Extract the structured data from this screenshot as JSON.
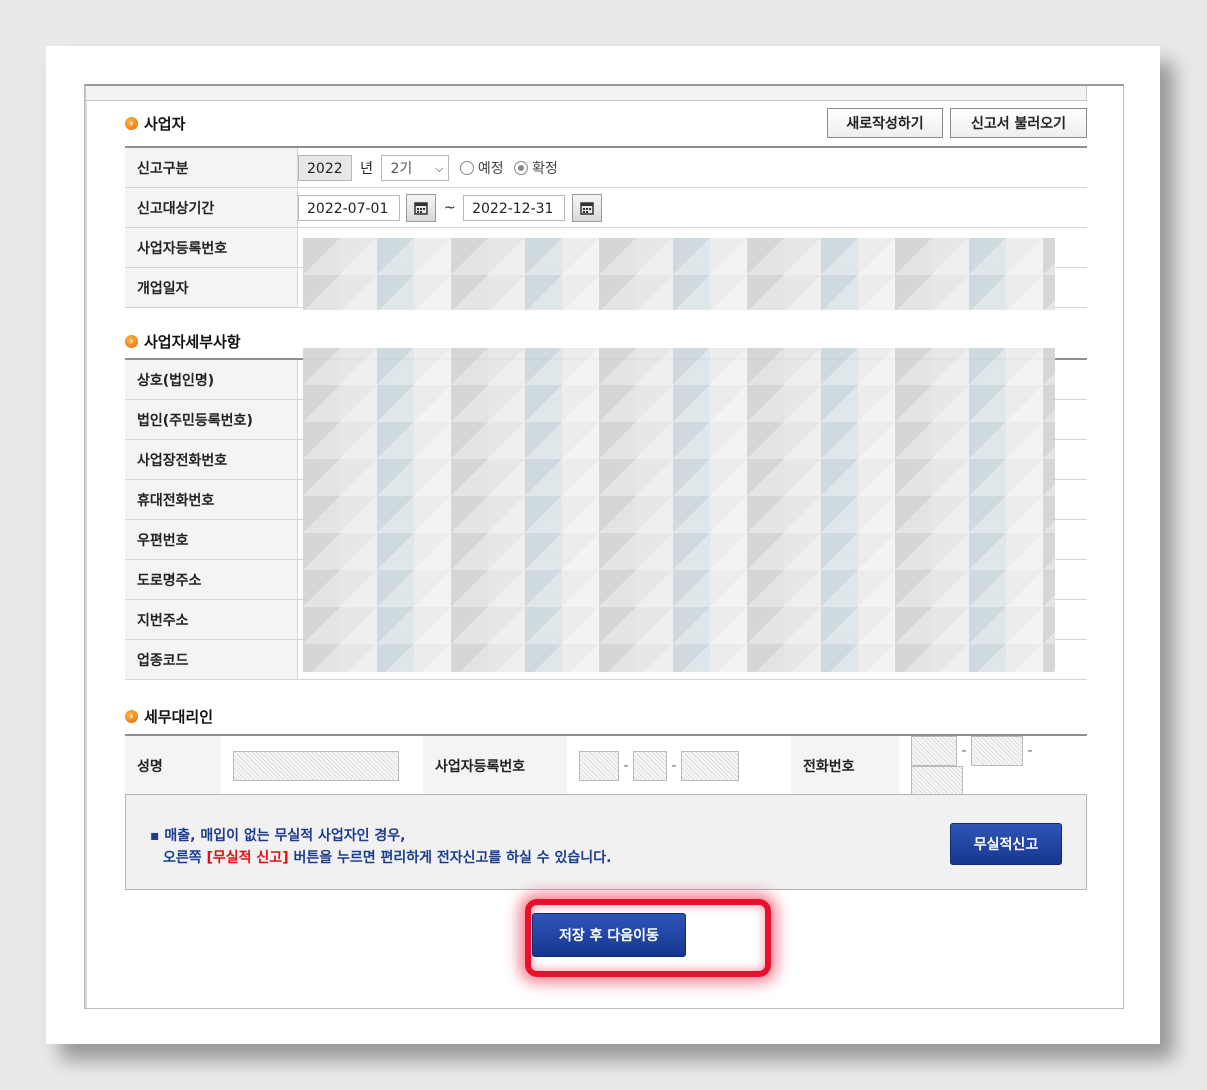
{
  "section_business": {
    "title": "사업자",
    "new_button": "새로작성하기",
    "load_button": "신고서 불러오기",
    "rows": {
      "report_type_label": "신고구분",
      "period_label": "신고대상기간",
      "reg_no_label": "사업자등록번호",
      "open_date_label": "개업일자"
    },
    "year_value": "2022",
    "year_unit": "년",
    "term_value": "2기",
    "radio_planned": "예정",
    "radio_confirmed": "확정",
    "selected_radio": "확정",
    "period_from": "2022-07-01",
    "period_sep": "~",
    "period_to": "2022-12-31"
  },
  "section_detail": {
    "title": "사업자세부사항",
    "labels": [
      "상호(법인명)",
      "법인(주민등록번호)",
      "사업장전화번호",
      "휴대전화번호",
      "우편번호",
      "도로명주소",
      "지번주소",
      "업종코드"
    ]
  },
  "section_agent": {
    "title": "세무대리인",
    "name_label": "성명",
    "reg_no_label": "사업자등록번호",
    "phone_label": "전화번호",
    "dash": "-"
  },
  "notice": {
    "line1": "▪ 매출, 매입이 없는 무실적 사업자인 경우,",
    "line2_pre": "오른쪽 ",
    "line2_red": "[무실적 신고]",
    "line2_post": " 버튼을 누르면 편리하게 전자신고를 하실 수 있습니다.",
    "no_record_button": "무실적신고"
  },
  "save_next_button": "저장 후 다음이동",
  "colors": {
    "accent_blue": "#1f45a5",
    "highlight_red": "#e8102d",
    "bullet_orange": "#f08a1c"
  }
}
